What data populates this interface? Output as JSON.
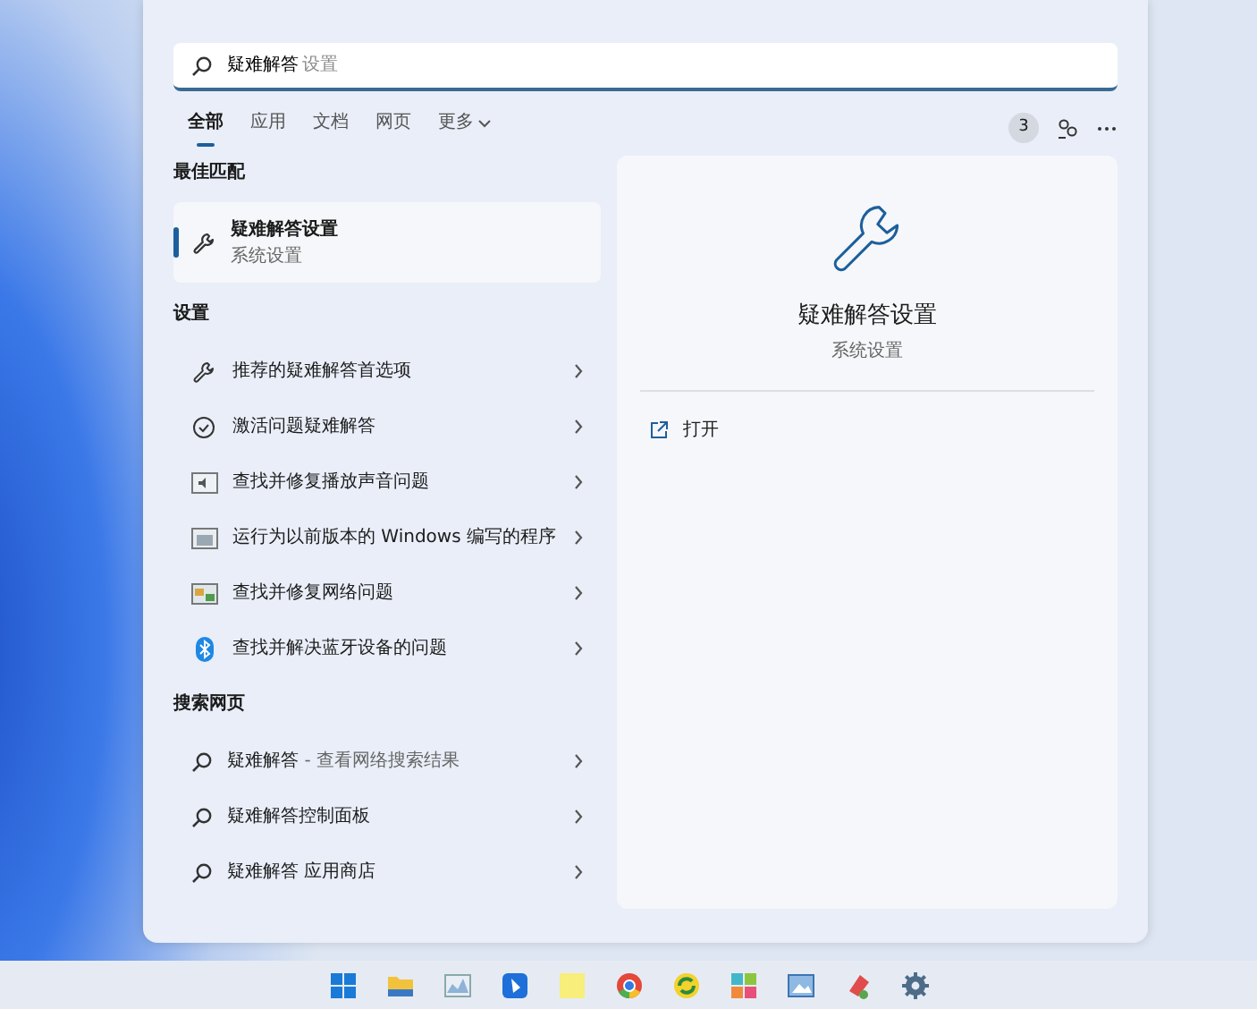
{
  "search": {
    "value": "疑难解答",
    "suggestion": "设置"
  },
  "tabs": [
    {
      "label": "全部",
      "selected": true,
      "kind": "tab"
    },
    {
      "label": "应用",
      "selected": false,
      "kind": "tab"
    },
    {
      "label": "文档",
      "selected": false,
      "kind": "tab"
    },
    {
      "label": "网页",
      "selected": false,
      "kind": "tab"
    },
    {
      "label": "更多",
      "selected": false,
      "kind": "menu"
    }
  ],
  "badge": "3",
  "best_match": {
    "heading": "最佳匹配",
    "title": "疑难解答设置",
    "subtitle": "系统设置",
    "selected": true
  },
  "settings": {
    "heading": "设置",
    "items": [
      {
        "kind": "wrench",
        "text": "推荐的疑难解答首选项"
      },
      {
        "kind": "check",
        "text": "激活问题疑难解答"
      },
      {
        "kind": "speaker",
        "text": "查找并修复播放声音问题"
      },
      {
        "kind": "app",
        "text": "运行为以前版本的 Windows 编写的程序"
      },
      {
        "kind": "network",
        "text": "查找并修复网络问题"
      },
      {
        "kind": "bluetooth",
        "text": "查找并解决蓝牙设备的问题"
      }
    ]
  },
  "web": {
    "heading": "搜索网页",
    "items": [
      {
        "text": "疑难解答",
        "suffix": "- 查看网络搜索结果"
      },
      {
        "text": "疑难解答控制面板"
      },
      {
        "text": "疑难解答 应用商店"
      }
    ]
  },
  "detail": {
    "title": "疑难解答设置",
    "subtitle": "系统设置",
    "actions": [
      {
        "label": "打开"
      }
    ]
  }
}
